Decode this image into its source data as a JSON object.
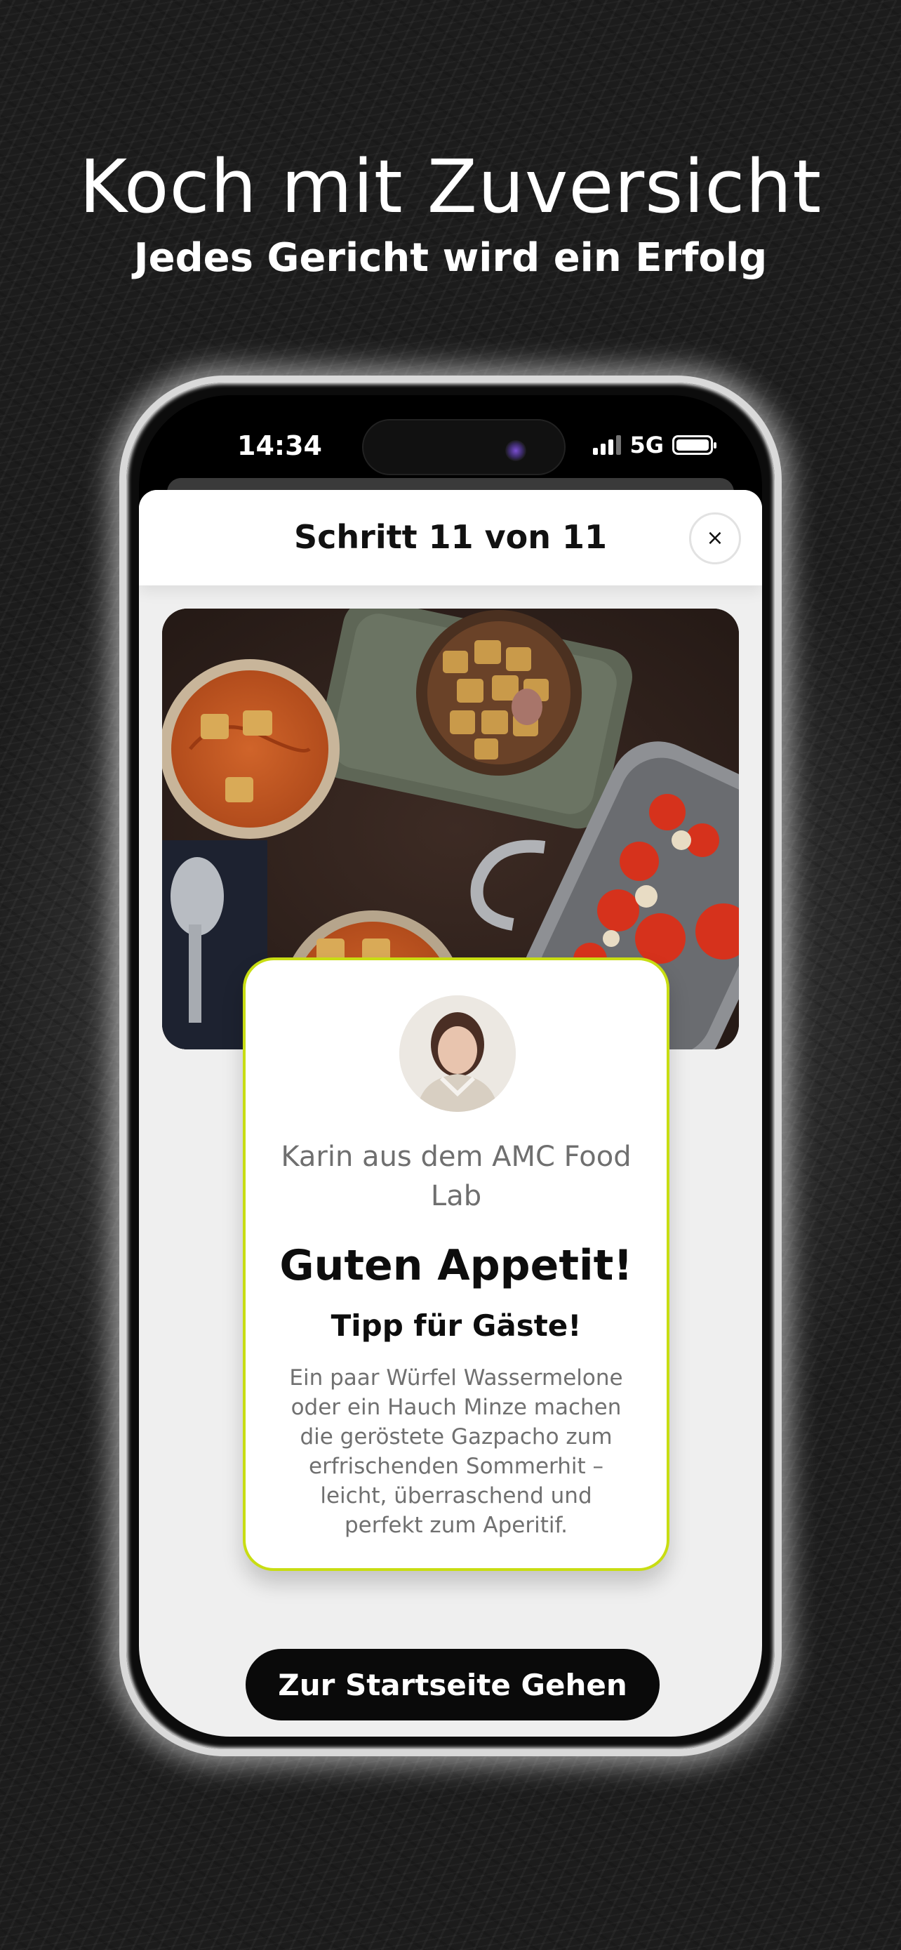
{
  "promo": {
    "headline": "Koch mit Zuversicht",
    "subheadline": "Jedes Gericht wird ein Erfolg"
  },
  "status_bar": {
    "time": "14:34",
    "network": "5G",
    "icons": [
      "signal-icon",
      "battery-icon"
    ]
  },
  "sheet": {
    "title": "Schritt 11 von 11",
    "close_icon": "×"
  },
  "tip": {
    "author": "Karin aus dem AMC Food Lab",
    "title": "Guten Appetit!",
    "subtitle": "Tipp für Gäste!",
    "body": "Ein paar Würfel Wassermelone oder ein Hauch Minze machen die geröstete Gazpacho zum erfrischenden Sommerhit – leicht, überraschend und perfekt zum Aperitif."
  },
  "actions": {
    "home_label": "Zur Startseite Gehen"
  },
  "colors": {
    "accent_border": "#c8dd12",
    "button_bg": "#0a0a0a",
    "sheet_bg": "#efefef"
  }
}
